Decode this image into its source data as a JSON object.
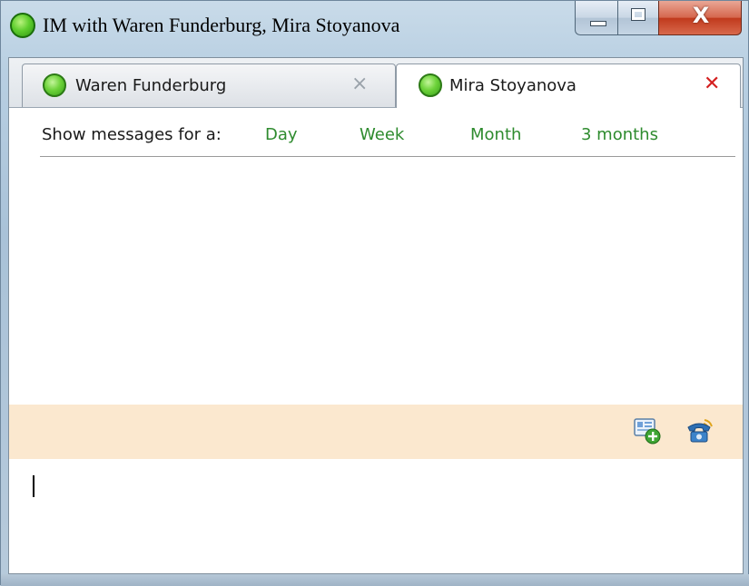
{
  "window": {
    "title": "IM with Waren Funderburg, Mira Stoyanova",
    "controls": {
      "minimize": "minimize",
      "maximize": "maximize",
      "close": "X"
    }
  },
  "tabs": [
    {
      "label": "Waren Funderburg",
      "close": "×",
      "active": false,
      "status": "online"
    },
    {
      "label": "Mira Stoyanova",
      "close": "✕",
      "active": true,
      "status": "online"
    }
  ],
  "filter": {
    "label": "Show messages for a:",
    "options": [
      "Day",
      "Week",
      "Month",
      "3 months"
    ]
  },
  "toolbar": {
    "icons": [
      "add-contact-icon",
      "phone-call-icon"
    ]
  },
  "colors": {
    "link_green": "#2e8b2e",
    "toolbar_bg": "#fbe8cf",
    "active_close_red": "#d42020",
    "status_green": "#5fce2e"
  }
}
